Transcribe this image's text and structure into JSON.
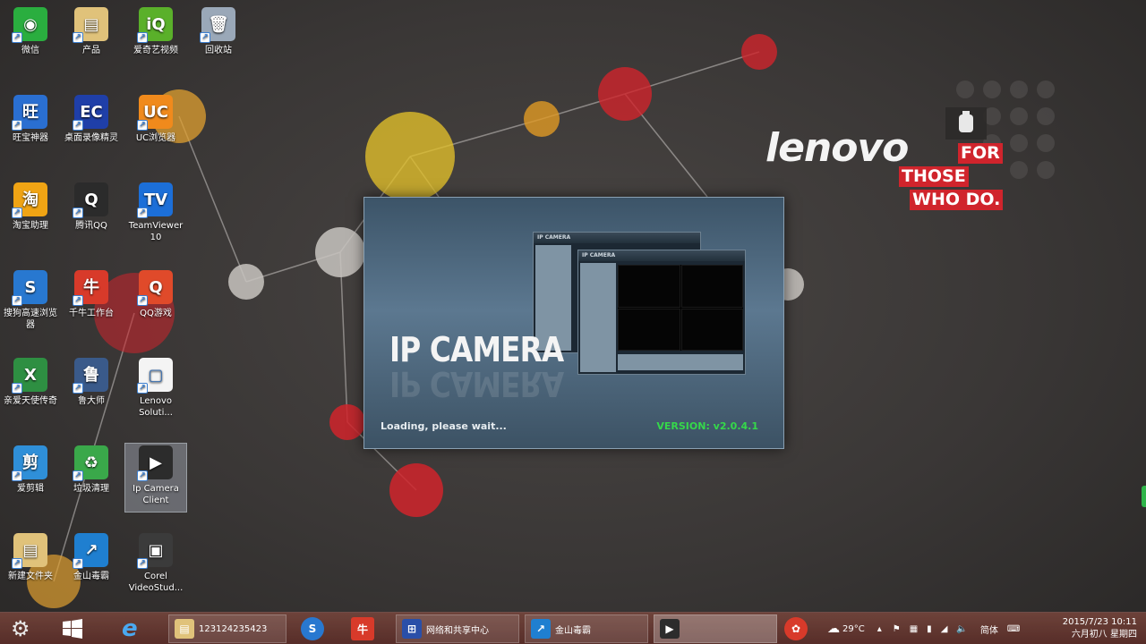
{
  "desktop": {
    "icons": [
      {
        "label": "微信",
        "color": "#2aae3f",
        "glyph": "◉"
      },
      {
        "label": "产品",
        "color": "#e0c27a",
        "glyph": "▤"
      },
      {
        "label": "爱奇艺视频",
        "color": "#5ab02a",
        "glyph": "iQ"
      },
      {
        "label": "回收站",
        "color": "#9aa8b8",
        "glyph": "🗑"
      },
      {
        "label": "旺宝神器",
        "color": "#2a6fd1",
        "glyph": "旺"
      },
      {
        "label": "桌面录像精灵",
        "color": "#1f3fa8",
        "glyph": "EC"
      },
      {
        "label": "UC浏览器",
        "color": "#f08a1c",
        "glyph": "UC"
      },
      {
        "label": "淘宝助理",
        "color": "#f0a414",
        "glyph": "淘"
      },
      {
        "label": "腾讯QQ",
        "color": "#2b2b2b",
        "glyph": "Q"
      },
      {
        "label": "TeamViewer 10",
        "color": "#1c6fd8",
        "glyph": "TV"
      },
      {
        "label": "搜狗高速浏览器",
        "color": "#2878d0",
        "glyph": "S"
      },
      {
        "label": "千牛工作台",
        "color": "#d83a2a",
        "glyph": "牛"
      },
      {
        "label": "QQ游戏",
        "color": "#e04a2a",
        "glyph": "Q"
      },
      {
        "label": "亲爱天使传奇",
        "color": "#2e8f42",
        "glyph": "X"
      },
      {
        "label": "鲁大师",
        "color": "#3a5a8a",
        "glyph": "鲁"
      },
      {
        "label": "Lenovo Soluti...",
        "color": "#f4f4f4",
        "glyph": "▢"
      },
      {
        "label": "爱剪辑",
        "color": "#2f8fd8",
        "glyph": "剪"
      },
      {
        "label": "垃圾清理",
        "color": "#3aa84a",
        "glyph": "♻"
      },
      {
        "label": "Ip Camera Client",
        "color": "#2c2c2c",
        "glyph": "▶"
      },
      {
        "label": "新建文件夹",
        "color": "#e0c27a",
        "glyph": "▤"
      },
      {
        "label": "金山毒霸",
        "color": "#1f7fd0",
        "glyph": "↗"
      },
      {
        "label": "Corel VideoStud...",
        "color": "#3b3b3b",
        "glyph": "▣"
      }
    ]
  },
  "wallpaper": {
    "brand": "lenovo",
    "tagline": [
      "FOR",
      "THOSE",
      "WHO DO."
    ]
  },
  "splash": {
    "title": "IP CAMERA",
    "loading": "Loading, please wait...",
    "version": "VERSION: v2.0.4.1",
    "mini_title_back": "IP CAMERA",
    "mini_title_front": "IP CAMERA"
  },
  "taskbar": {
    "settings_icon": "gear-icon",
    "start_icon": "windows-start-icon",
    "tasks": [
      {
        "label": "123124235423",
        "icon": "folder-icon",
        "color": "#e0c27a"
      },
      {
        "label": "网络和共享中心",
        "icon": "network-icon",
        "color": "#2a4fa8"
      },
      {
        "label": "金山毒霸",
        "icon": "shield-icon",
        "color": "#1f7fd0"
      },
      {
        "label": "",
        "icon": "ip-camera-icon",
        "color": "#2c2c2c"
      }
    ],
    "tray": {
      "weather": "29°C",
      "ime": "简体"
    },
    "clock": {
      "time": "2015/7/23 10:11",
      "date": "六月初八 星期四"
    }
  }
}
